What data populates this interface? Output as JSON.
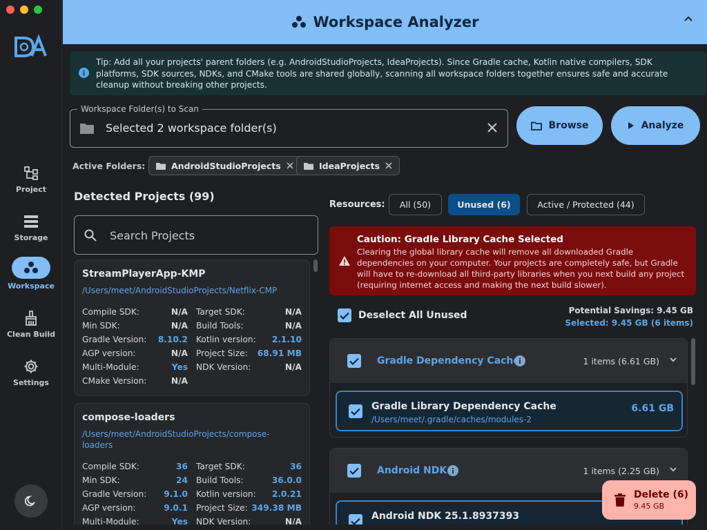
{
  "window": {
    "traffic_colors": [
      "#ff5f57",
      "#febc2e",
      "#28c840"
    ]
  },
  "sidebar": {
    "items": [
      {
        "label": "Project",
        "icon": "hierarchy-icon"
      },
      {
        "label": "Storage",
        "icon": "storage-icon"
      },
      {
        "label": "Workspace",
        "icon": "workspace-icon",
        "active": true
      },
      {
        "label": "Clean Build",
        "icon": "broom-icon"
      },
      {
        "label": "Settings",
        "icon": "gear-icon"
      }
    ],
    "theme_icon": "moon-icon"
  },
  "header": {
    "title": "Workspace Analyzer",
    "icon": "workspace-icon"
  },
  "tip": {
    "text": "Tip: Add all your projects' parent folders (e.g. AndroidStudioProjects, IdeaProjects). Since Gradle cache, Kotlin native compilers, SDK platforms, SDK sources, NDKs, and CMake tools are shared globally, scanning all workspace folders together ensures safe and accurate cleanup without breaking other projects."
  },
  "folder_field": {
    "legend": "Workspace Folder(s) to Scan",
    "value": "Selected 2 workspace folder(s)"
  },
  "buttons": {
    "browse": "Browse",
    "analyze": "Analyze"
  },
  "active_folders": {
    "label": "Active Folders:",
    "chips": [
      "AndroidStudioProjects",
      "IdeaProjects"
    ]
  },
  "projects": {
    "title": "Detected Projects (99)",
    "search_placeholder": "Search Projects",
    "cards": [
      {
        "name": "StreamPlayerApp-KMP",
        "path": "/Users/meet/AndroidStudioProjects/Netflix-CMP",
        "left": [
          {
            "k": "Compile SDK:",
            "v": "N/A",
            "blue": false
          },
          {
            "k": "Min SDK:",
            "v": "N/A",
            "blue": false
          },
          {
            "k": "Gradle Version:",
            "v": "8.10.2",
            "blue": true
          },
          {
            "k": "AGP version:",
            "v": "N/A",
            "blue": false
          },
          {
            "k": "Multi-Module:",
            "v": "Yes",
            "blue": true
          },
          {
            "k": "CMake Version:",
            "v": "N/A",
            "blue": false
          }
        ],
        "right": [
          {
            "k": "Target SDK:",
            "v": "N/A",
            "blue": false
          },
          {
            "k": "Build Tools:",
            "v": "N/A",
            "blue": false
          },
          {
            "k": "Kotlin version:",
            "v": "2.1.10",
            "blue": true
          },
          {
            "k": "Project Size:",
            "v": "68.91 MB",
            "blue": true
          },
          {
            "k": "NDK Version:",
            "v": "N/A",
            "blue": false
          }
        ]
      },
      {
        "name": "compose-loaders",
        "path": "/Users/meet/AndroidStudioProjects/compose-loaders",
        "left": [
          {
            "k": "Compile SDK:",
            "v": "36",
            "blue": true
          },
          {
            "k": "Min SDK:",
            "v": "24",
            "blue": true
          },
          {
            "k": "Gradle Version:",
            "v": "9.1.0",
            "blue": true
          },
          {
            "k": "AGP version:",
            "v": "9.0.1",
            "blue": true
          },
          {
            "k": "Multi-Module:",
            "v": "Yes",
            "blue": true
          }
        ],
        "right": [
          {
            "k": "Target SDK:",
            "v": "36",
            "blue": true
          },
          {
            "k": "Build Tools:",
            "v": "36.0.0",
            "blue": true
          },
          {
            "k": "Kotlin version:",
            "v": "2.0.21",
            "blue": true
          },
          {
            "k": "Project Size:",
            "v": "349.38 MB",
            "blue": true
          },
          {
            "k": "NDK Version:",
            "v": "N/A",
            "blue": false
          }
        ]
      }
    ]
  },
  "resources": {
    "label": "Resources:",
    "tabs": [
      "All (50)",
      "Unused (6)",
      "Active / Protected (44)"
    ],
    "selected_tab": 1,
    "caution": {
      "title": "Caution: Gradle Library Cache Selected",
      "body": "Clearing the global library cache will remove all downloaded Gradle dependencies on your computer. Your projects are completely safe, but Gradle will have to re-download all third-party libraries when you next build any project (requiring internet access and making the next build slower)."
    },
    "deselect_label": "Deselect All Unused",
    "potential_savings": "Potential Savings: 9.45 GB",
    "selected_summary": "Selected: 9.45 GB (6 items)",
    "groups": [
      {
        "title": "Gradle Dependency Cache",
        "count": "1 items (6.61 GB)",
        "item": {
          "name": "Gradle Library Dependency Cache",
          "path": "/Users/meet/.gradle/caches/modules-2",
          "size": "6.61 GB"
        }
      },
      {
        "title": "Android NDK",
        "count": "1 items (2.25 GB)",
        "item": {
          "name": "Android NDK 25.1.8937393",
          "path": "",
          "size": ""
        }
      }
    ]
  },
  "delete_button": {
    "label": "Delete (6)",
    "size": "9.45 GB"
  },
  "colors": {
    "accent": "#82bdf6",
    "link_blue": "#5aa6e8",
    "caution_bg": "#7b0c0d",
    "delete_bg": "#ffb4ab"
  }
}
